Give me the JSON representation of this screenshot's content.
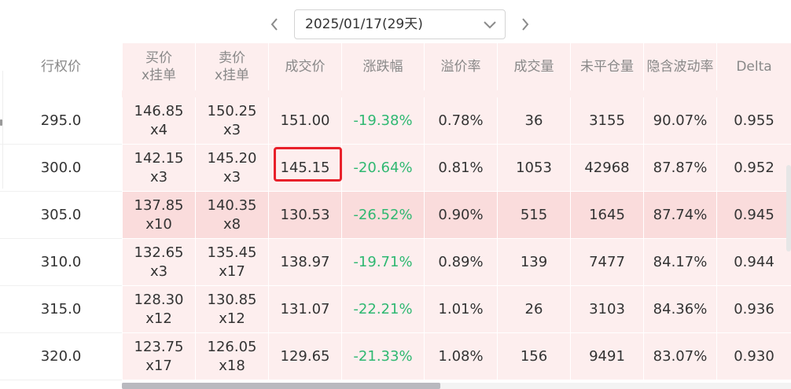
{
  "date_nav": {
    "selected": "2025/01/17(29天)",
    "prev_icon": "chevron-left-icon",
    "next_icon": "chevron-right-icon",
    "caret_icon": "chevron-down-icon"
  },
  "columns": {
    "strike": "行权价",
    "bid_line1": "买价",
    "bid_line2": "x挂单",
    "ask_line1": "卖价",
    "ask_line2": "x挂单",
    "last": "成交价",
    "change": "涨跌幅",
    "premium": "溢价率",
    "volume": "成交量",
    "open_interest": "未平仓量",
    "iv": "隐含波动率",
    "delta": "Delta"
  },
  "rows": [
    {
      "strike": "295.0",
      "bid": "146.85",
      "bid_size": "x4",
      "ask": "150.25",
      "ask_size": "x3",
      "last": "151.00",
      "change": "-19.38%",
      "premium": "0.78%",
      "volume": "36",
      "oi": "3155",
      "iv": "90.07%",
      "delta": "0.955"
    },
    {
      "strike": "300.0",
      "bid": "142.15",
      "bid_size": "x3",
      "ask": "145.20",
      "ask_size": "x3",
      "last": "145.15",
      "change": "-20.64%",
      "premium": "0.81%",
      "volume": "1053",
      "oi": "42968",
      "iv": "87.87%",
      "delta": "0.952"
    },
    {
      "strike": "305.0",
      "bid": "137.85",
      "bid_size": "x10",
      "ask": "140.35",
      "ask_size": "x8",
      "last": "130.53",
      "change": "-26.52%",
      "premium": "0.90%",
      "volume": "515",
      "oi": "1645",
      "iv": "87.74%",
      "delta": "0.945"
    },
    {
      "strike": "310.0",
      "bid": "132.65",
      "bid_size": "x3",
      "ask": "135.45",
      "ask_size": "x17",
      "last": "138.97",
      "change": "-19.71%",
      "premium": "0.89%",
      "volume": "139",
      "oi": "7477",
      "iv": "84.17%",
      "delta": "0.944"
    },
    {
      "strike": "315.0",
      "bid": "128.30",
      "bid_size": "x12",
      "ask": "130.85",
      "ask_size": "x12",
      "last": "131.07",
      "change": "-22.21%",
      "premium": "1.01%",
      "volume": "26",
      "oi": "3103",
      "iv": "84.36%",
      "delta": "0.936"
    },
    {
      "strike": "320.0",
      "bid": "123.75",
      "bid_size": "x17",
      "ask": "126.05",
      "ask_size": "x18",
      "last": "129.65",
      "change": "-21.33%",
      "premium": "1.08%",
      "volume": "156",
      "oi": "9491",
      "iv": "83.07%",
      "delta": "0.930"
    }
  ],
  "colors": {
    "in_the_money_bg": "#fdeeee",
    "highlight_row_bg": "#fadcdc",
    "negative_change": "#2fb871",
    "selection_box": "#e8202a",
    "header_text": "#888888"
  }
}
